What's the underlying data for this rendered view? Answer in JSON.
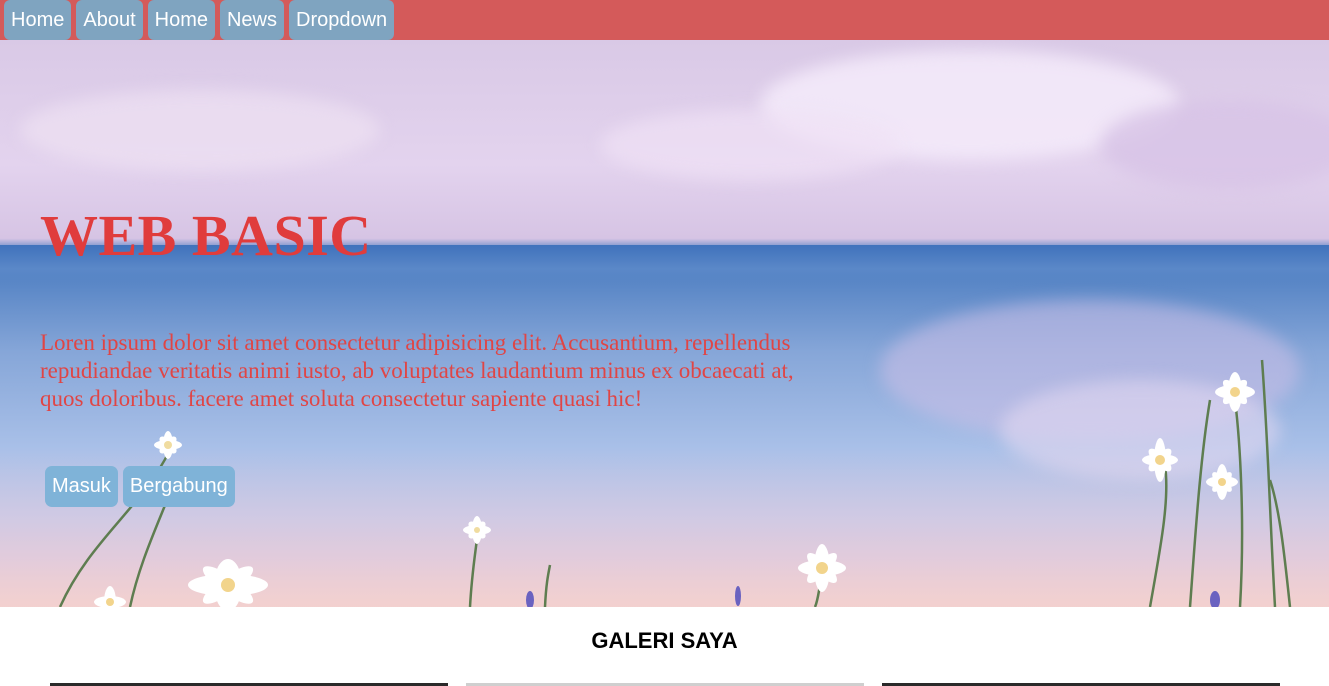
{
  "navbar": {
    "items": [
      {
        "label": "Home"
      },
      {
        "label": "About"
      },
      {
        "label": "Home"
      },
      {
        "label": "News"
      },
      {
        "label": "Dropdown"
      }
    ]
  },
  "hero": {
    "title": "WEB BASIC",
    "text": "Loren ipsum dolor sit amet consectetur adipisicing elit. Accusantium, repellendus repudiandae veritatis animi iusto, ab voluptates laudantium minus ex obcaecati at, quos doloribus. facere amet soluta consectetur sapiente quasi hic!",
    "buttons": {
      "login": "Masuk",
      "join": "Bergabung"
    }
  },
  "gallery": {
    "title": "GALERI SAYA"
  },
  "colors": {
    "navbar_bg": "#d45a5a",
    "nav_item_bg": "#7fa4c0",
    "title_color": "#e03c3c",
    "button_bg": "#7fb3d8"
  }
}
